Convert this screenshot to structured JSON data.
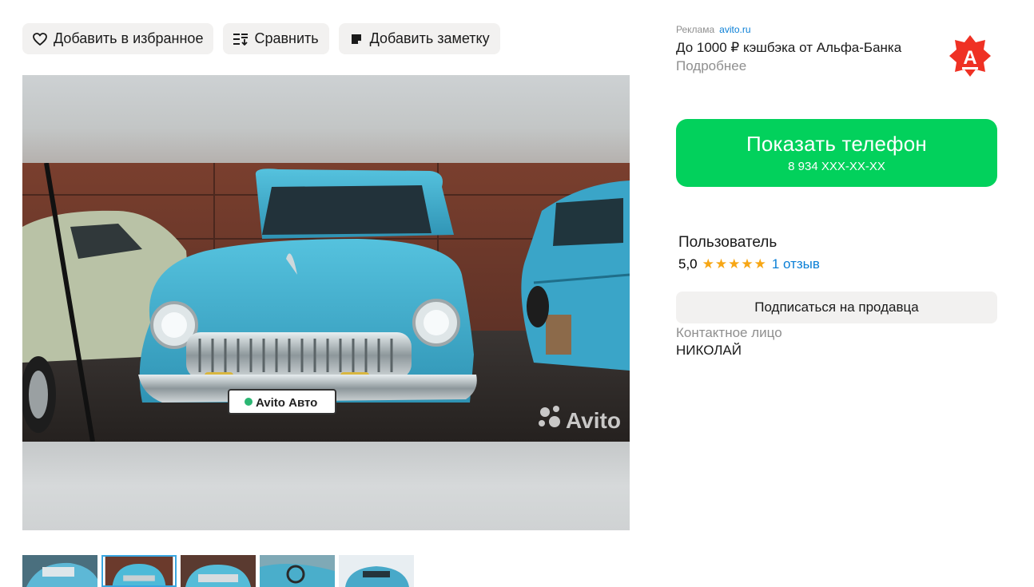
{
  "actions": {
    "favorite": "Добавить в избранное",
    "compare": "Сравнить",
    "note": "Добавить заметку"
  },
  "gallery": {
    "plate_text": "Avito Авто",
    "watermark": "Avito",
    "thumbnail_count": 5,
    "active_thumbnail": 2
  },
  "ad": {
    "label": "Реклама",
    "source": "avito.ru",
    "title": "До 1000 ₽ кэшбэка от Альфа-Банка",
    "more": "Подробнее",
    "logo_letter": "А"
  },
  "phone": {
    "label": "Показать телефон",
    "number": "8 934 XXX-XX-XX"
  },
  "seller": {
    "name": "Пользователь",
    "rating": "5,0",
    "stars": "★★★★★",
    "reviews": "1 отзыв",
    "subscribe": "Подписаться на продавца"
  },
  "contact": {
    "label": "Контактное лицо",
    "name": "НИКОЛАЙ"
  },
  "colors": {
    "phone_button": "#02d15c",
    "link": "#0a7fd6",
    "star": "#f7a614",
    "alfa_red": "#ef3124",
    "action_bg": "#f2f1f0"
  }
}
